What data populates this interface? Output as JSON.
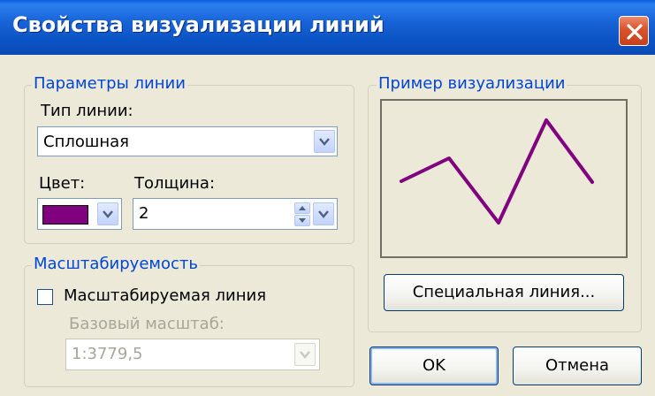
{
  "window": {
    "title": "Свойства визуализации линий"
  },
  "line_params": {
    "legend": "Параметры линии",
    "type_label": "Тип линии:",
    "type_value": "Сплошная",
    "color_label": "Цвет:",
    "color_swatch": "#800080",
    "thickness_label": "Толщина:",
    "thickness_value": "2"
  },
  "scaling": {
    "legend": "Масштабируемость",
    "checkbox_label": "Масштабируемая линия",
    "checked": false,
    "base_scale_label": "Базовый масштаб:",
    "base_scale_value": "1:3779,5"
  },
  "preview": {
    "legend": "Пример визуализации",
    "line_color": "#800080",
    "special_button": "Специальная линия..."
  },
  "buttons": {
    "ok": "OK",
    "cancel": "Отмена"
  },
  "colors": {
    "title_bar": "#0b53c4",
    "group_legend": "#0046d5",
    "dialog_bg": "#ece9d8"
  },
  "icons": [
    "close-icon",
    "chevron-down-icon",
    "spin-up-icon",
    "spin-down-icon"
  ]
}
